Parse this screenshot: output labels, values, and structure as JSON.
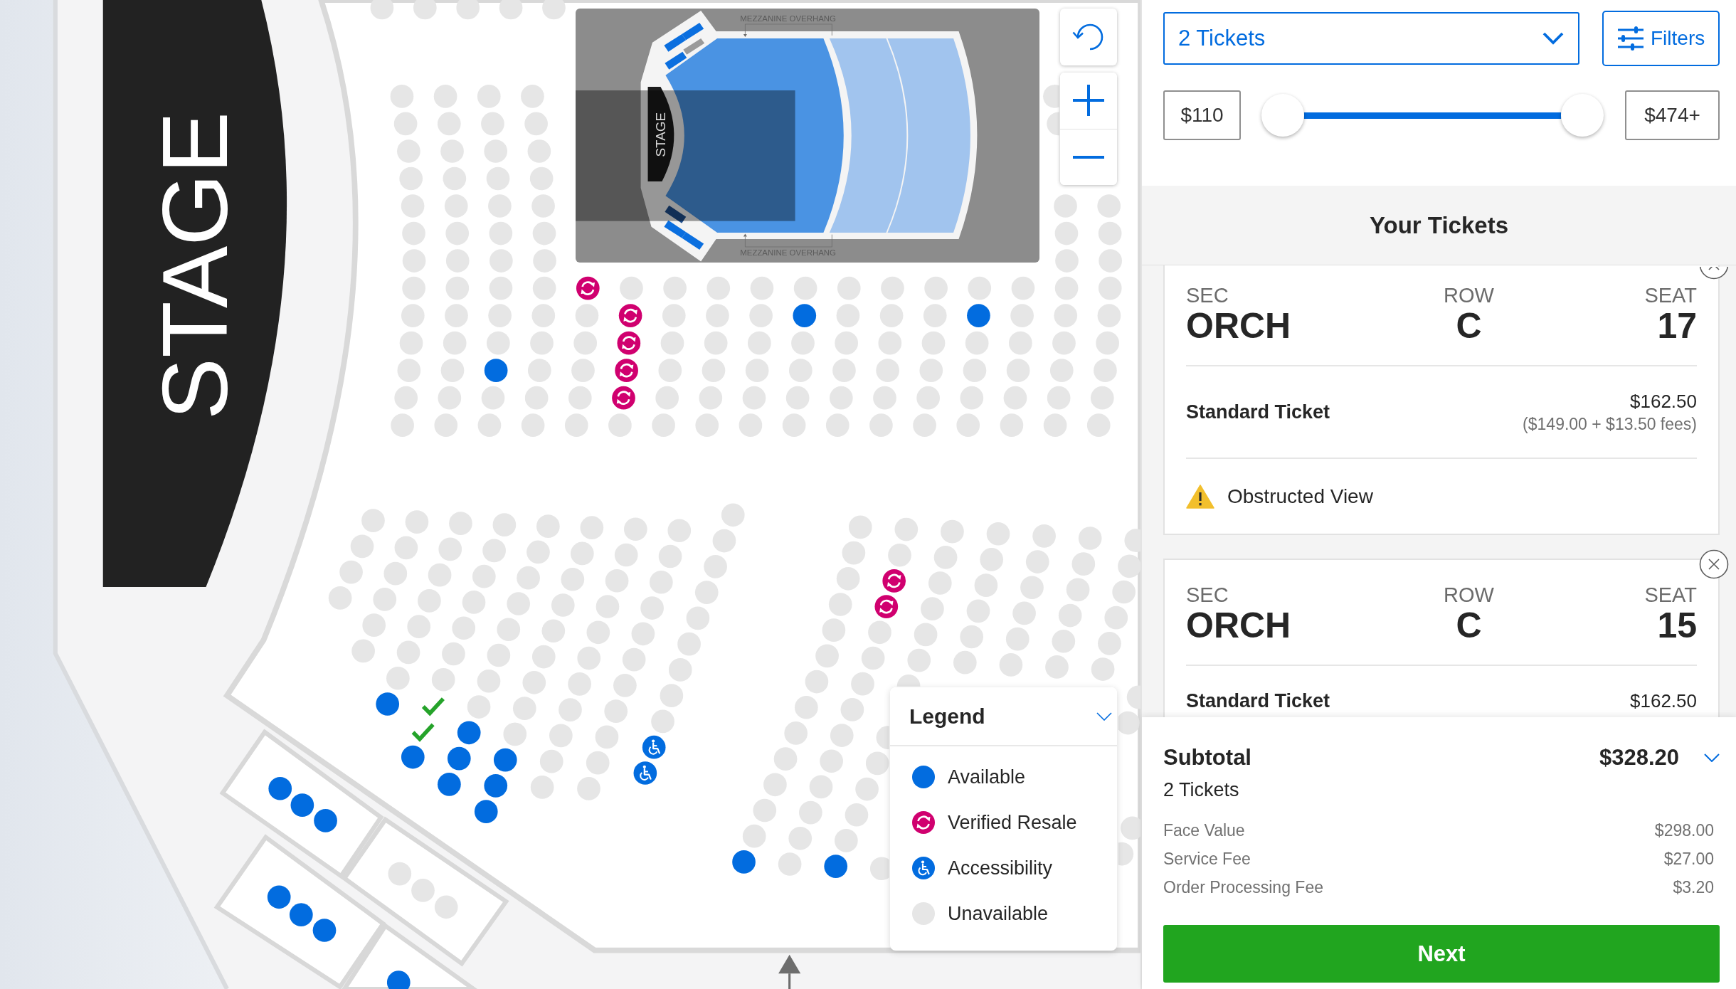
{
  "seat_map": {
    "stage_label": "STAGE"
  },
  "minimap": {
    "stage_label": "STAGE",
    "overhang_labels": [
      "MEZZANINE OVERHANG",
      "MEZZANINE OVERHANG"
    ]
  },
  "legend": {
    "title": "Legend",
    "expanded": true,
    "items": [
      {
        "label": "Available",
        "kind": "available",
        "color": "#026cdf"
      },
      {
        "label": "Verified Resale",
        "kind": "resale",
        "color": "#d0006f"
      },
      {
        "label": "Accessibility",
        "kind": "accessible",
        "color": "#026cdf"
      },
      {
        "label": "Unavailable",
        "kind": "unavailable",
        "color": "#e6e6e6"
      }
    ]
  },
  "ticket_quantity": {
    "value": "2 Tickets"
  },
  "filters_button": {
    "label": "Filters"
  },
  "price_range": {
    "min": {
      "value": "$110"
    },
    "max": {
      "value": "$474+"
    },
    "low_handle": {
      "level": 0
    },
    "high_handle": {
      "level": 1
    }
  },
  "your_tickets": {
    "title": "Your Tickets",
    "tickets": [
      {
        "sec_label": "SEC",
        "sec": "ORCH",
        "row_label": "ROW",
        "row": "C",
        "seat_label": "SEAT",
        "seat": "17",
        "type": "Standard Ticket",
        "price": "$162.50",
        "price_detail": "($149.00 + $13.50 fees)",
        "note": "Obstructed View"
      },
      {
        "sec_label": "SEC",
        "sec": "ORCH",
        "row_label": "ROW",
        "row": "C",
        "seat_label": "SEAT",
        "seat": "15",
        "type": "Standard Ticket",
        "price": "$162.50"
      }
    ]
  },
  "summary": {
    "label": "Subtotal",
    "amount": "$328.20",
    "expanded": true,
    "ticket_count": "2 Tickets",
    "lines": [
      {
        "label": "Face Value",
        "amount": "$298.00"
      },
      {
        "label": "Service Fee",
        "amount": "$27.00"
      },
      {
        "label": "Order Processing Fee",
        "amount": "$3.20"
      }
    ]
  },
  "next_button": {
    "label": "Next"
  }
}
